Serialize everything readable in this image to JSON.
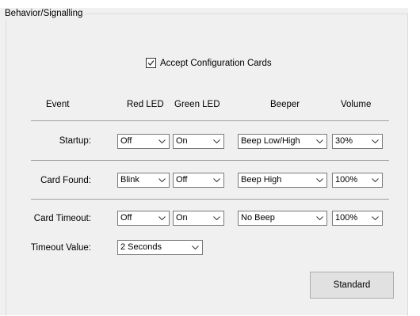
{
  "group": {
    "title": "Behavior/Signalling"
  },
  "accept_config": {
    "label": "Accept Configuration Cards",
    "checked": true
  },
  "headers": {
    "event": "Event",
    "red_led": "Red LED",
    "green_led": "Green LED",
    "beeper": "Beeper",
    "volume": "Volume"
  },
  "rows": [
    {
      "label": "Startup:",
      "red_led": "Off",
      "green_led": "On",
      "beeper": "Beep Low/High",
      "volume": "30%"
    },
    {
      "label": "Card Found:",
      "red_led": "Blink",
      "green_led": "Off",
      "beeper": "Beep High",
      "volume": "100%"
    },
    {
      "label": "Card Timeout:",
      "red_led": "Off",
      "green_led": "On",
      "beeper": "No Beep",
      "volume": "100%"
    }
  ],
  "timeout": {
    "label": "Timeout Value:",
    "value": "2 Seconds"
  },
  "standard_button": {
    "label": "Standard"
  },
  "icons": {
    "dropdown": "chevron-down-icon",
    "check": "check-icon"
  }
}
